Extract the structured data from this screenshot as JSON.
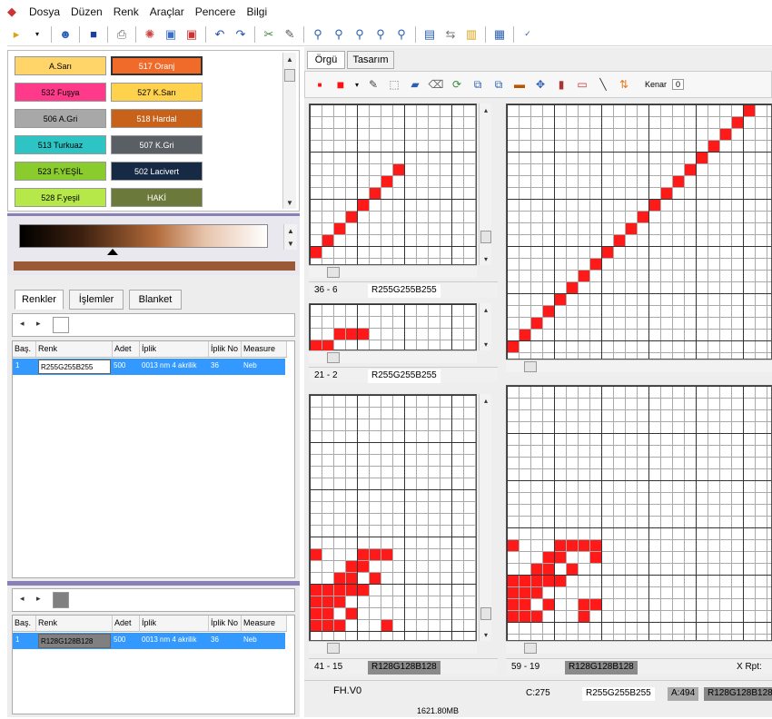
{
  "menu": [
    "Dosya",
    "Düzen",
    "Renk",
    "Araçlar",
    "Pencere",
    "Bilgi"
  ],
  "swatches": [
    {
      "label": "A.Sarı",
      "color": "#ffd56a",
      "text": "#000"
    },
    {
      "label": "517 Oranj",
      "color": "#f06a2a",
      "text": "#fff"
    },
    {
      "label": "532 Fuşya",
      "color": "#ff3a8a",
      "text": "#000"
    },
    {
      "label": "527 K.Sarı",
      "color": "#ffd24d",
      "text": "#000"
    },
    {
      "label": "506 A.Gri",
      "color": "#a8a8a8",
      "text": "#000"
    },
    {
      "label": "518 Hardal",
      "color": "#c8621a",
      "text": "#fff"
    },
    {
      "label": "513 Turkuaz",
      "color": "#2ec4c4",
      "text": "#000"
    },
    {
      "label": "507 K.Gri",
      "color": "#5a5f66",
      "text": "#fff"
    },
    {
      "label": "523 F.YEŞİL",
      "color": "#8acb2e",
      "text": "#000"
    },
    {
      "label": "502 Lacivert",
      "color": "#172a45",
      "text": "#fff"
    },
    {
      "label": "528 F.yeşil",
      "color": "#b6e84a",
      "text": "#000"
    },
    {
      "label": "HAKİ",
      "color": "#6b7a3a",
      "text": "#fff"
    }
  ],
  "tabs": [
    "Renkler",
    "İşlemler",
    "Blanket"
  ],
  "table_headers": [
    "Baş.",
    "Renk",
    "Adet",
    "İplik",
    "İplik No",
    "Measure"
  ],
  "table1_row": {
    "index": "1",
    "renk": "R255G255B255",
    "adet": "500",
    "iplik": "0013 nm 4 akrilik",
    "no": "36",
    "measure": "Neb"
  },
  "table2_row": {
    "index": "1",
    "renk": "R128G128B128",
    "adet": "500",
    "iplik": "0013 nm 4 akrilik",
    "no": "36",
    "measure": "Neb"
  },
  "right_tabs": [
    "Örgü",
    "Tasarım"
  ],
  "kenar_label": "Kenar",
  "kenar_value": "0",
  "status": {
    "tl_pos": "36 - 6",
    "tl_color": "R255G255B255",
    "ml_pos": "21 - 2",
    "ml_color": "R255G255B255",
    "bl_pos": "41 - 15",
    "bl_color": "R128G128B128",
    "br_pos": "59 - 19",
    "br_color": "R128G128B128",
    "x_rpt": "X Rpt:",
    "file": "FH.V0",
    "c_val": "C:275",
    "c_color": "R255G255B255",
    "a_val": "A:494",
    "a_color": "R128G128B128",
    "memory": "1621.80MB"
  }
}
